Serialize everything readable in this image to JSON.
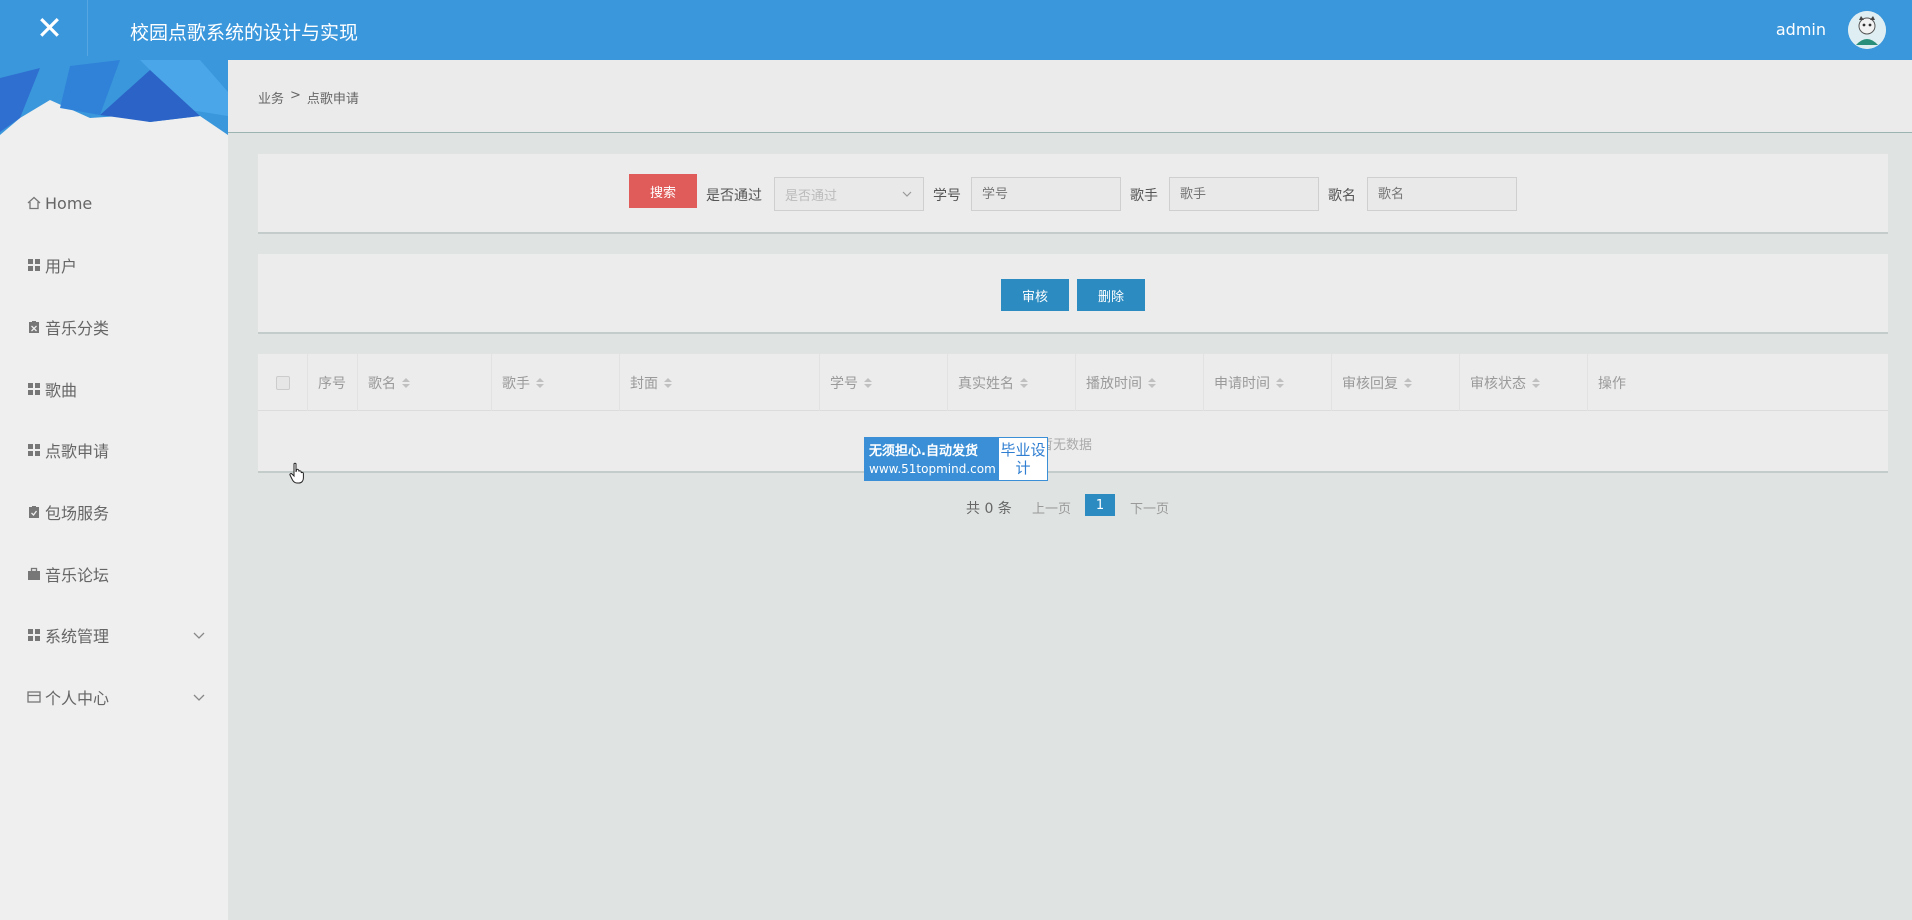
{
  "header": {
    "app_title": "校园点歌系统的设计与实现",
    "user_name": "admin"
  },
  "sidebar": {
    "items": [
      {
        "label": "Home",
        "icon": "home-icon"
      },
      {
        "label": "用户",
        "icon": "grid-icon"
      },
      {
        "label": "音乐分类",
        "icon": "clipboard-icon"
      },
      {
        "label": "歌曲",
        "icon": "grid-icon"
      },
      {
        "label": "点歌申请",
        "icon": "grid-icon"
      },
      {
        "label": "包场服务",
        "icon": "clipboard-check-icon"
      },
      {
        "label": "音乐论坛",
        "icon": "briefcase-icon"
      },
      {
        "label": "系统管理",
        "icon": "grid-icon",
        "expandable": true
      },
      {
        "label": "个人中心",
        "icon": "card-icon",
        "expandable": true
      }
    ]
  },
  "breadcrumb": {
    "root": "业务",
    "sep": ">",
    "current": "点歌申请"
  },
  "search": {
    "button_label": "搜索",
    "passed_label": "是否通过",
    "passed_placeholder": "是否通过",
    "student_no_label": "学号",
    "student_no_placeholder": "学号",
    "singer_label": "歌手",
    "singer_placeholder": "歌手",
    "song_label": "歌名",
    "song_placeholder": "歌名"
  },
  "actions": {
    "review_label": "审核",
    "delete_label": "删除"
  },
  "table": {
    "columns": [
      "序号",
      "歌名",
      "歌手",
      "封面",
      "学号",
      "真实姓名",
      "播放时间",
      "申请时间",
      "审核回复",
      "审核状态",
      "操作"
    ],
    "empty_text": "暂无数据"
  },
  "pager": {
    "total": "共 0 条",
    "prev": "上一页",
    "current_page": "1",
    "next": "下一页"
  },
  "watermark": {
    "line1": "无须担心.自动发货",
    "line2": "www.51topmind.com",
    "right": "毕业设计"
  },
  "colors": {
    "topbar": "#3a97dc",
    "search_button": "#e05c5a",
    "primary_button": "#2c8bc1"
  }
}
